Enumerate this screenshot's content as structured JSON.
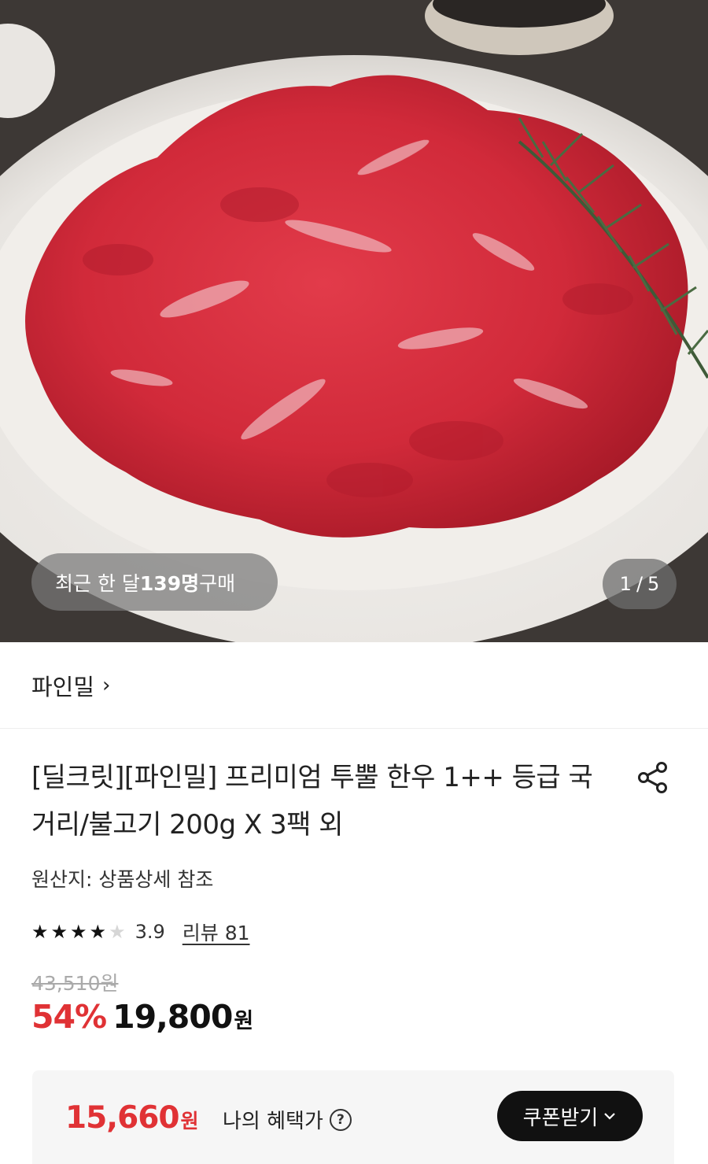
{
  "hero": {
    "purchase_prefix": "최근 한 달 ",
    "purchase_count": "139명",
    "purchase_suffix": " 구매",
    "image_index": "1",
    "image_sep": "/",
    "image_total": "5"
  },
  "brand": {
    "name": "파인밀",
    "chevron": "›"
  },
  "product": {
    "title": "[딜크릿][파인밀] 프리미엄 투뿔 한우 1++ 등급 국거리/불고기 200g X 3팩 외",
    "origin": "원산지: 상품상세 참조"
  },
  "rating": {
    "stars_filled": 4,
    "stars_total": 5,
    "value": "3.9",
    "review_label": "리뷰 81"
  },
  "price": {
    "original": "43,510원",
    "discount": "54%",
    "sale": "19,800",
    "currency": "원"
  },
  "benefit": {
    "price": "15,660",
    "currency": "원",
    "label": "나의 혜택가",
    "help": "?",
    "coupon_label": "쿠폰받기",
    "coupon_chevron": "⌄"
  },
  "colors": {
    "accent_red": "#e03235",
    "dark": "#111111"
  },
  "icons": [
    "share-icon",
    "star-icon",
    "chevron-right-icon",
    "question-circle-icon",
    "chevron-down-icon"
  ]
}
